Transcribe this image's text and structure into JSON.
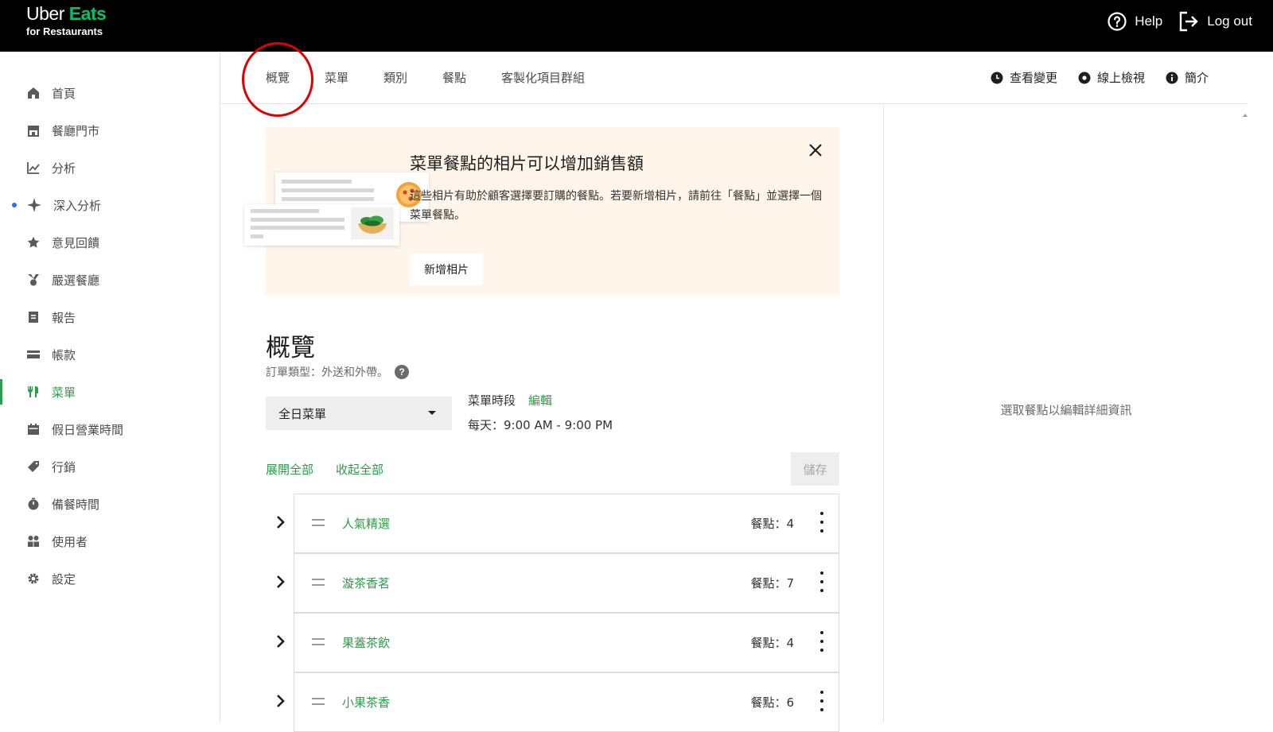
{
  "header": {
    "logo_uber": "Uber",
    "logo_eats": "Eats",
    "logo_sub": "for Restaurants",
    "help_label": "Help",
    "logout_label": "Log out"
  },
  "sidebar": {
    "items": [
      {
        "label": "首頁",
        "icon": "home-icon"
      },
      {
        "label": "餐廳門市",
        "icon": "store-icon"
      },
      {
        "label": "分析",
        "icon": "chart-icon"
      },
      {
        "label": "深入分析",
        "icon": "sparkle-icon"
      },
      {
        "label": "意見回饋",
        "icon": "star-icon"
      },
      {
        "label": "嚴選餐廳",
        "icon": "medal-icon"
      },
      {
        "label": "報告",
        "icon": "report-icon"
      },
      {
        "label": "帳款",
        "icon": "payment-icon"
      },
      {
        "label": "菜單",
        "icon": "utensils-icon",
        "active": true
      },
      {
        "label": "假日營業時間",
        "icon": "calendar-icon"
      },
      {
        "label": "行銷",
        "icon": "tag-icon"
      },
      {
        "label": "備餐時間",
        "icon": "timer-icon"
      },
      {
        "label": "使用者",
        "icon": "users-icon"
      },
      {
        "label": "設定",
        "icon": "gear-icon"
      }
    ]
  },
  "tabs": {
    "items": [
      "概覽",
      "菜單",
      "類別",
      "餐點",
      "客製化項目群組"
    ],
    "active": "概覽",
    "view_changes": "查看變更",
    "preview_online": "線上檢視",
    "intro": "簡介"
  },
  "banner": {
    "title": "菜單餐點的相片可以增加銷售額",
    "body": "這些相片有助於顧客選擇要訂購的餐點。若要新增相片，請前往「餐點」並選擇一個菜單餐點。",
    "button": "新增相片"
  },
  "overview": {
    "title": "概覽",
    "order_type": "訂單類型：外送和外帶。",
    "help_badge": "?",
    "menu_select": "全日菜單",
    "menu_hours_label": "菜單時段",
    "edit_label": "編輯",
    "menu_hours": "每天：9:00 AM - 9:00 PM",
    "expand_all": "展開全部",
    "collapse_all": "收起全部",
    "save": "儲存"
  },
  "categories": [
    {
      "name": "人氣精選",
      "count": "餐點：4"
    },
    {
      "name": "漩茶香茗",
      "count": "餐點：7"
    },
    {
      "name": "果蓋茶飲",
      "count": "餐點：4"
    },
    {
      "name": "小果茶香",
      "count": "餐點：6"
    }
  ],
  "right_panel": {
    "empty_text": "選取餐點以編輯詳細資訊"
  },
  "colors": {
    "brand_green": "#06c167",
    "link_green": "#2e9c4a",
    "banner_bg": "#fff5ea",
    "annotation_red": "#e00000"
  }
}
